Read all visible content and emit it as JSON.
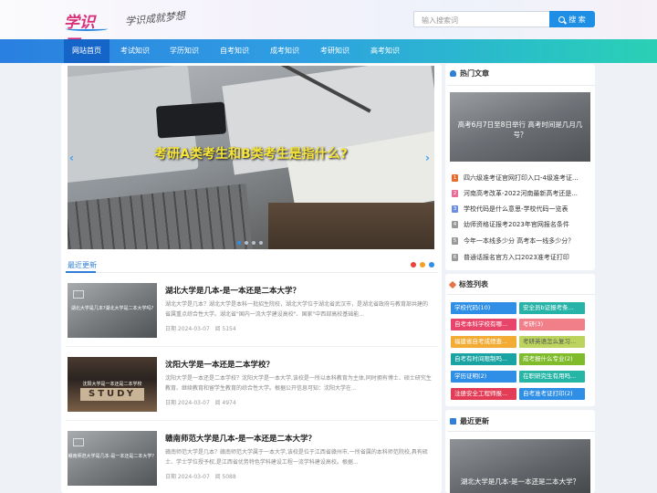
{
  "header": {
    "logo_text": "学识网",
    "slogan": "学识成就梦想",
    "search_placeholder": "输入搜索词",
    "search_button": "搜 索"
  },
  "nav": {
    "items": [
      "网站首页",
      "考试知识",
      "学历知识",
      "自考知识",
      "成考知识",
      "考研知识",
      "高考知识"
    ]
  },
  "banner": {
    "title": "考研A类考生和B类考生是指什么?",
    "prev": "‹",
    "next": "›"
  },
  "latest": {
    "heading": "最近更新",
    "articles": [
      {
        "thumb_caption": "湖北大学是几本?湖北大学是二本大学吗?",
        "title": "湖北大学是几本-是一本还是二本大学？",
        "desc": "湖北大学是几本？湖北大学是本科一批招生院校，湖北大学位于湖北省武汉市，是湖北省政府与教育部共建的省属重点综合性大学。湖北省\"国内一流大学建设高校\"、国家\"中西部高校基础能...",
        "date": "日期 2024-03-07",
        "views": "阅 5154"
      },
      {
        "thumb_caption": "沈阳大学是一本还是二本学校",
        "title": "沈阳大学是一本还是二本学校？",
        "desc": "沈阳大学是一本还是二本学校？沈阳大学是一本大学,该校是一所以本科教育为主体,同时拥有博士、硕士研究生教育、继续教育和留学生教育的综合性大学。根据公开信息可知：沈阳大学在...",
        "date": "日期 2024-03-07",
        "views": "阅 4974"
      },
      {
        "thumb_caption": "赣南师范大学是几本-是一本还是二本大学？",
        "title": "赣南师范大学是几本-是一本还是二本大学？",
        "desc": "赣南师范大学是几本？赣南师范大学属于一本大学,该校是位于江西省赣州市,一所省属的本科师范院校,具有硕士、学士学位授予权,是江西省优势特色学科建设工程一流学科建设高校。根据...",
        "date": "日期 2024-03-07",
        "views": "阅 5088"
      }
    ]
  },
  "hot": {
    "heading": "热门文章",
    "image_caption": "高考6月7日至8日举行 高考时间是几月几号？",
    "items": [
      {
        "num": "1",
        "text": "四六级准考证官网打印入口-4级准考证..."
      },
      {
        "num": "2",
        "text": "河南高考改革-2022河南最新高考还是..."
      },
      {
        "num": "3",
        "text": "学校代码是什么意思-学校代码一览表"
      },
      {
        "num": "4",
        "text": "幼师资格证报考2023年官网报名条件"
      },
      {
        "num": "5",
        "text": "今年一本线多少分 高考本一线多少分？"
      },
      {
        "num": "6",
        "text": "普通话报名官方入口2023准考证打印"
      }
    ]
  },
  "tags": {
    "heading": "标签列表",
    "items": [
      "学校代码(10)",
      "安全员b证报考条...",
      "自考本科学校有哪...",
      "考研(3)",
      "福建省自考成绩查...",
      "考研英语怎么复习...",
      "自考有时间限制吗...",
      "成考报什么专业(2)",
      "学历证明(2)",
      "在职研究生有用吗...",
      "注册安全工程师报...",
      "自考准考证打印(2)"
    ],
    "colors": [
      "#2f8fe6",
      "#27b3a8",
      "#e8456a",
      "#f17f8a",
      "#f2ab33",
      "#bcd35d",
      "#19a3a3",
      "#7fbb2a",
      "#2f8fe6",
      "#26b6a6",
      "#e33c56",
      "#2f8fe6"
    ]
  },
  "recent": {
    "heading": "最近更新",
    "image_caption": "湖北大学是几本-是一本还是二本大学？"
  },
  "colors": {
    "accent": "#2f7fd8",
    "nav_active": "#1565c8",
    "banner_title": "#f7e53a",
    "dot_red": "#e8423a",
    "dot_orange": "#f2a227",
    "dot_blue": "#2f8fe6"
  }
}
